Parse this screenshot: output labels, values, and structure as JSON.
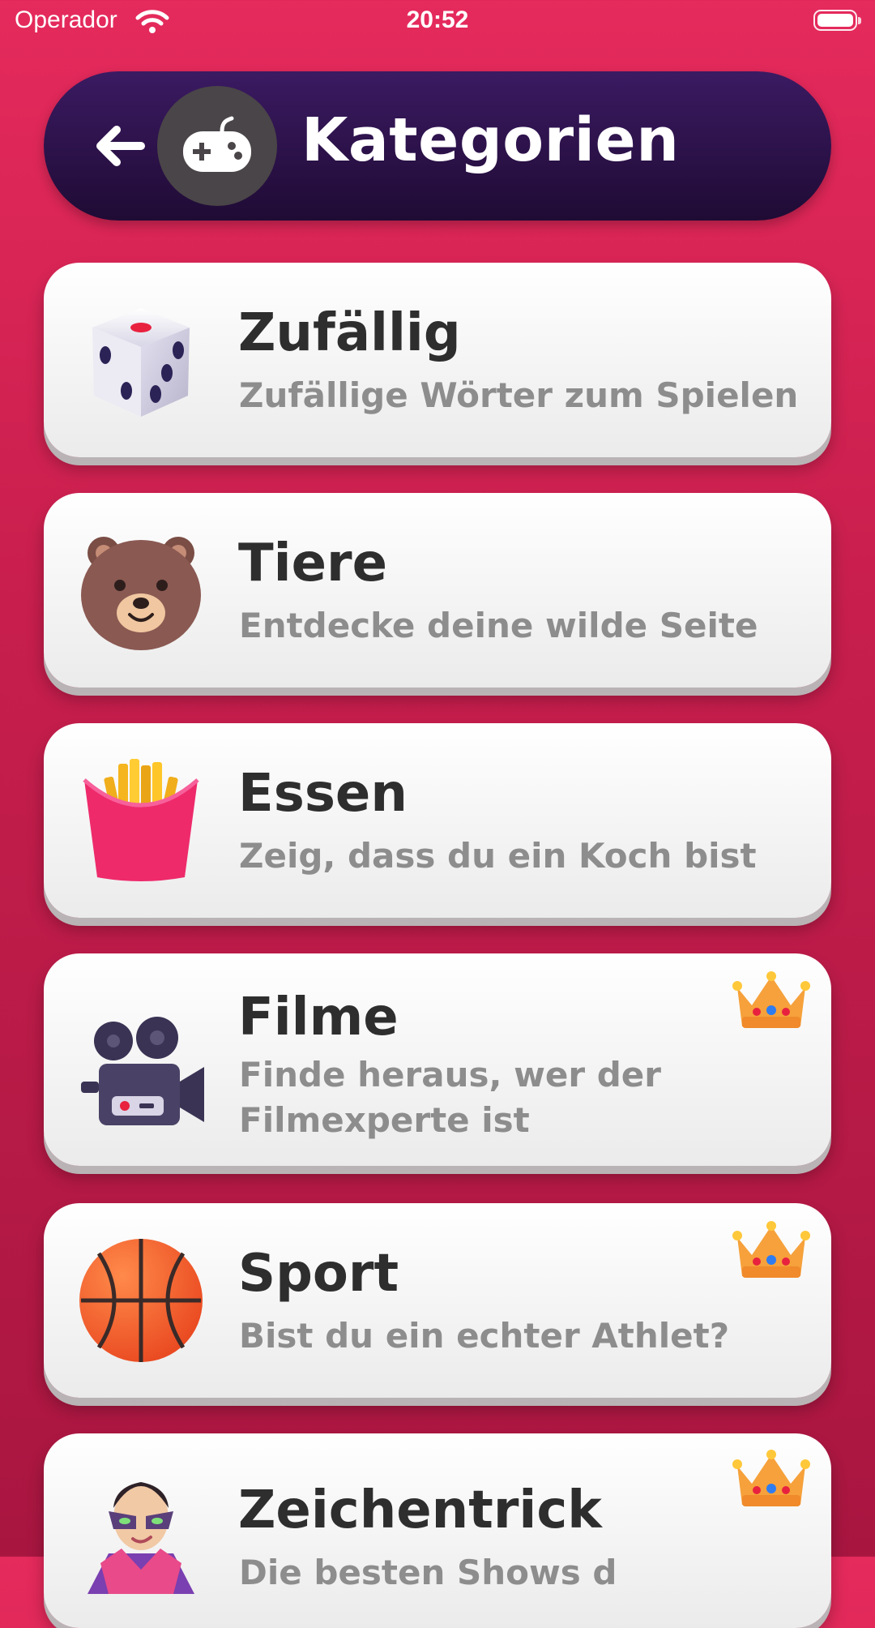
{
  "status_bar": {
    "carrier": "Operador",
    "time": "20:52"
  },
  "header": {
    "title": "Kategorien",
    "back_icon": "arrow-left-icon",
    "category_icon": "gamepad-icon"
  },
  "categories": [
    {
      "title": "Zufällig",
      "subtitle": "Zufällige Wörter zum Spielen",
      "icon": "dice-icon",
      "premium": false
    },
    {
      "title": "Tiere",
      "subtitle": "Entdecke deine wilde Seite",
      "icon": "bear-icon",
      "premium": false
    },
    {
      "title": "Essen",
      "subtitle": "Zeig, dass du ein Koch bist",
      "icon": "fries-icon",
      "premium": false
    },
    {
      "title": "Filme",
      "subtitle": "Finde heraus, wer der Filmexperte ist",
      "icon": "movie-camera-icon",
      "premium": true
    },
    {
      "title": "Sport",
      "subtitle": "Bist du ein echter Athlet?",
      "icon": "basketball-icon",
      "premium": true
    },
    {
      "title": "Zeichentrick",
      "subtitle": "Die besten Shows d",
      "icon": "superhero-icon",
      "premium": true
    }
  ],
  "colors": {
    "background": "#d4245a",
    "header": "#2a0f45",
    "card": "#ffffff",
    "title": "#2e2e2e",
    "subtitle": "#8d8d8d"
  }
}
